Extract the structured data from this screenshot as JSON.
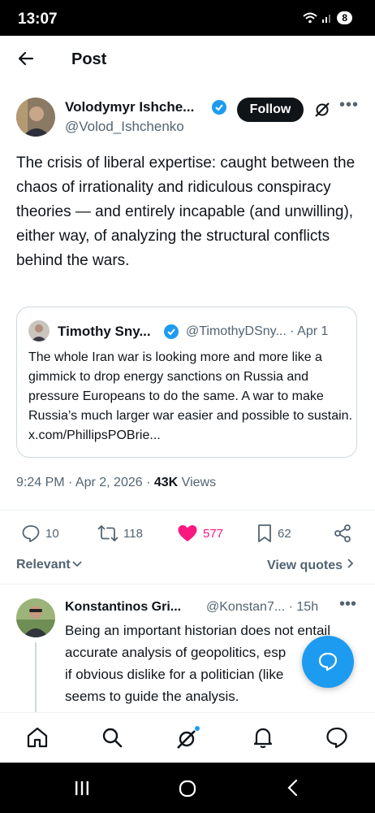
{
  "status_bar": {
    "time": "13:07",
    "battery": "8"
  },
  "header": {
    "title": "Post"
  },
  "post": {
    "author_name": "Volodymyr Ishche...",
    "author_handle": "@Volod_Ishchenko",
    "follow_label": "Follow",
    "text": "The crisis of liberal expertise: caught between the chaos of irrationality and ridiculous conspiracy theories — and entirely incapable (and unwilling), either way, of analyzing the structural conflicts behind the wars.",
    "quote": {
      "name": "Timothy Sny...",
      "meta": "@TimothyDSny... · Apr 1",
      "text": "The whole Iran war is looking more and more like a gimmick to drop energy sanctions on Russia and pressure Europeans to do the same. A war to make Russia’s much larger war easier and possible to sustain. x.com/PhillipsPOBrie..."
    },
    "timestamp": "9:24 PM · Apr 2, 2026 · ",
    "views_count": "43K",
    "views_label": " Views",
    "stats": {
      "replies": "10",
      "reposts": "118",
      "likes": "577",
      "bookmarks": "62"
    }
  },
  "filters": {
    "sort_label": "Relevant",
    "view_quotes_label": "View quotes"
  },
  "reply": {
    "name": "Konstantinos Gri...",
    "meta": "@Konstan7... · 15h",
    "lines": [
      "Being an important historian does not entail",
      "accurate analysis of geopolitics, esp",
      "if obvious dislike for a politician (like",
      "seems to guide the analysis."
    ]
  },
  "colors": {
    "accent": "#1d9bf0",
    "like": "#f91880",
    "text": "#0f1419",
    "muted": "#536471"
  },
  "icons": [
    "back-arrow-icon",
    "verified-icon",
    "grok-icon",
    "more-icon",
    "reply-icon",
    "repost-icon",
    "heart-icon",
    "bookmark-icon",
    "share-icon",
    "home-icon",
    "search-icon",
    "bell-icon",
    "messages-icon",
    "compose-icon"
  ]
}
